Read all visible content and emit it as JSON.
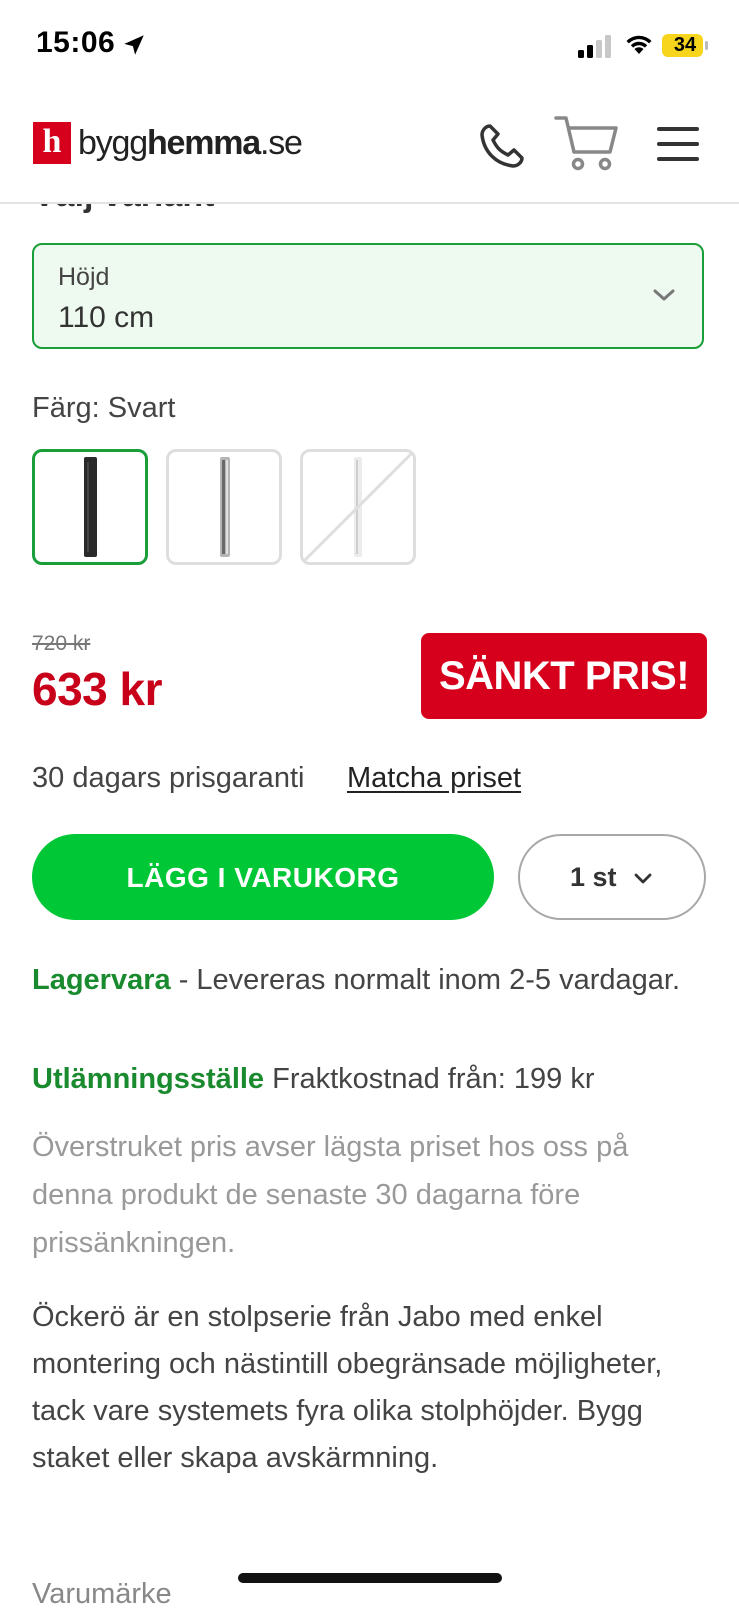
{
  "status_bar": {
    "time": "15:06",
    "battery": "34",
    "icons": [
      "location-arrow-icon",
      "signal-icon",
      "wifi-icon",
      "battery-icon"
    ]
  },
  "header": {
    "logo_mark": "h",
    "logo_text_light": "bygg",
    "logo_text_bold": "hemma",
    "logo_text_suffix": ".se",
    "icons": [
      "phone-icon",
      "cart-icon",
      "menu-icon"
    ],
    "brand_color": "#d6001c"
  },
  "product": {
    "cut_heading": "Välj variant",
    "variant_select": {
      "label": "Höjd",
      "value": "110 cm"
    },
    "color_label": "Färg: Svart",
    "swatches": [
      {
        "name": "Svart",
        "selected": true,
        "available": true
      },
      {
        "name": "Galvaniserad",
        "selected": false,
        "available": true
      },
      {
        "name": "Vit",
        "selected": false,
        "available": false
      }
    ],
    "old_price": "720 kr",
    "price": "633 kr",
    "promo_badge": "SÄNKT PRIS!",
    "guarantee": "30 dagars prisgaranti",
    "match_link": "Matcha priset",
    "add_to_cart": "LÄGG I VARUKORG",
    "quantity": "1 st",
    "stock_status": "Lagervara",
    "stock_text": " - Levereras normalt inom 2-5 vardagar.",
    "pickup_label": "Utlämningsställe",
    "pickup_text": " Fraktkostnad från: 199 kr",
    "disclaimer": "Överstruket pris avser lägsta priset hos oss på denna produkt de senaste 30 dagarna före prissänkningen.",
    "description": "Öckerö är en stolpserie från Jabo med enkel montering och nästintill obegränsade möjligheter, tack vare systemets fyra olika stolphöjder. Bygg staket eller skapa avskärmning.",
    "cut_bottom": "Varumärke"
  },
  "colors": {
    "accent_green": "#00c736",
    "text_green": "#1a8a2e",
    "price_red": "#c8001a",
    "badge_red": "#d6001c"
  }
}
